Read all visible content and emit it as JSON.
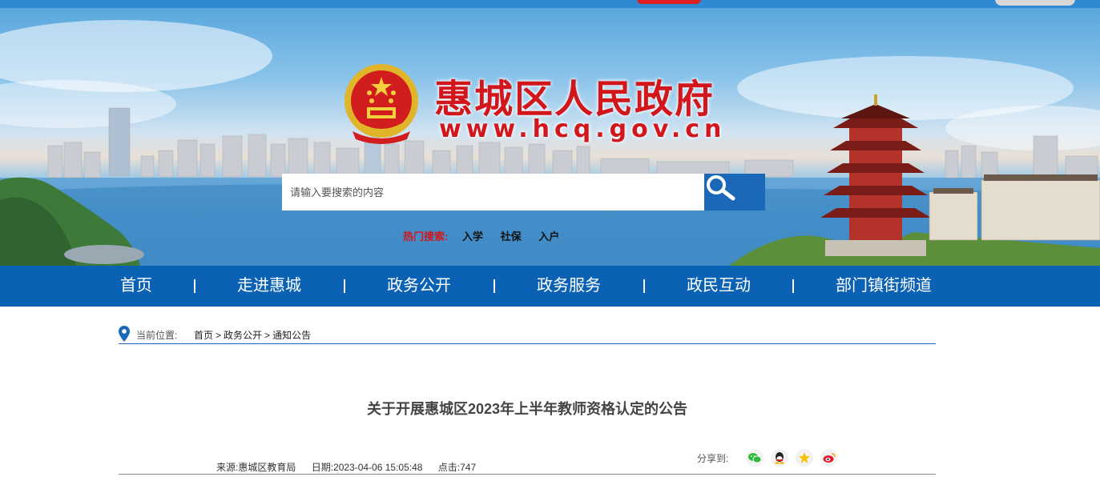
{
  "banner": {
    "site_title": "惠城区人民政府",
    "site_url": "www.hcq.gov.cn"
  },
  "search": {
    "placeholder": "请输入要搜索的内容",
    "button_icon": "search-icon"
  },
  "hot_search": {
    "label": "热门搜索:",
    "items": [
      "入学",
      "社保",
      "入户"
    ]
  },
  "nav": {
    "items": [
      "首页",
      "走进惠城",
      "政务公开",
      "政务服务",
      "政民互动",
      "部门镇街频道"
    ]
  },
  "breadcrumb": {
    "label": "当前位置:",
    "path": [
      "首页",
      "政务公开",
      "通知公告"
    ]
  },
  "article": {
    "title": "关于开展惠城区2023年上半年教师资格认定的公告",
    "source": "来源:惠城区教育局",
    "date": "日期:2023-04-06 15:05:48",
    "clicks": "点击:747"
  },
  "share": {
    "label": "分享到:",
    "icons": [
      "wechat-icon",
      "qq-icon",
      "qzone-icon",
      "weibo-icon"
    ]
  },
  "colors": {
    "brand_red": "#d1161c",
    "nav_blue": "#0b62b4",
    "search_button_blue": "#1c68b8"
  }
}
